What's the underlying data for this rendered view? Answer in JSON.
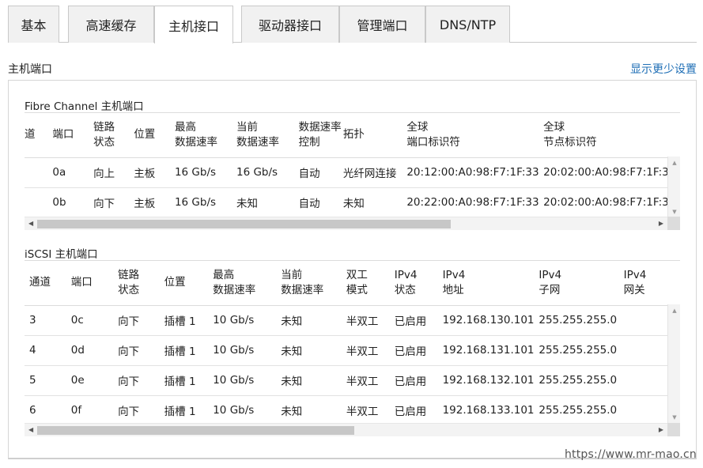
{
  "tabs": [
    {
      "label": "基本",
      "active": false
    },
    {
      "label": "高速缓存",
      "active": false
    },
    {
      "label": "主机接口",
      "active": true
    },
    {
      "label": "驱动器接口",
      "active": false
    },
    {
      "label": "管理端口",
      "active": false
    },
    {
      "label": "DNS/NTP",
      "active": false
    }
  ],
  "section_title": "主机端口",
  "show_less_link": "显示更少设置",
  "fc": {
    "title": "Fibre Channel 主机端口",
    "columns": [
      "道",
      "端口",
      "链路\n状态",
      "位置",
      "最高\n数据速率",
      "当前\n数据速率",
      "数据速率\n控制",
      "拓扑",
      "全球\n端口标识符",
      "全球\n节点标识符"
    ],
    "rows": [
      [
        "",
        "0a",
        "向上",
        "主板",
        "16 Gb/s",
        "16 Gb/s",
        "自动",
        "光纤网连接",
        "20:12:00:A0:98:F7:1F:33",
        "20:02:00:A0:98:F7:1F:33"
      ],
      [
        "",
        "0b",
        "向下",
        "主板",
        "16 Gb/s",
        "未知",
        "自动",
        "未知",
        "20:22:00:A0:98:F7:1F:33",
        "20:02:00:A0:98:F7:1F:33"
      ]
    ]
  },
  "iscsi": {
    "title": "iSCSI 主机端口",
    "columns": [
      "通道",
      "端口",
      "链路\n状态",
      "位置",
      "最高\n数据速率",
      "当前\n数据速率",
      "双工\n模式",
      "IPv4\n状态",
      "IPv4\n地址",
      "IPv4\n子网",
      "IPv4\n网关"
    ],
    "rows": [
      [
        "3",
        "0c",
        "向下",
        "插槽 1",
        "10 Gb/s",
        "未知",
        "半双工",
        "已启用",
        "192.168.130.101",
        "255.255.255.0",
        ""
      ],
      [
        "4",
        "0d",
        "向下",
        "插槽 1",
        "10 Gb/s",
        "未知",
        "半双工",
        "已启用",
        "192.168.131.101",
        "255.255.255.0",
        ""
      ],
      [
        "5",
        "0e",
        "向下",
        "插槽 1",
        "10 Gb/s",
        "未知",
        "半双工",
        "已启用",
        "192.168.132.101",
        "255.255.255.0",
        ""
      ],
      [
        "6",
        "0f",
        "向下",
        "插槽 1",
        "10 Gb/s",
        "未知",
        "半双工",
        "已启用",
        "192.168.133.101",
        "255.255.255.0",
        ""
      ]
    ]
  },
  "watermark": "https://www.mr-mao.cn",
  "colors": {
    "link": "#1f6fb6",
    "tab_inactive_bg": "#f1f1f1",
    "border": "#c9c9c9"
  }
}
